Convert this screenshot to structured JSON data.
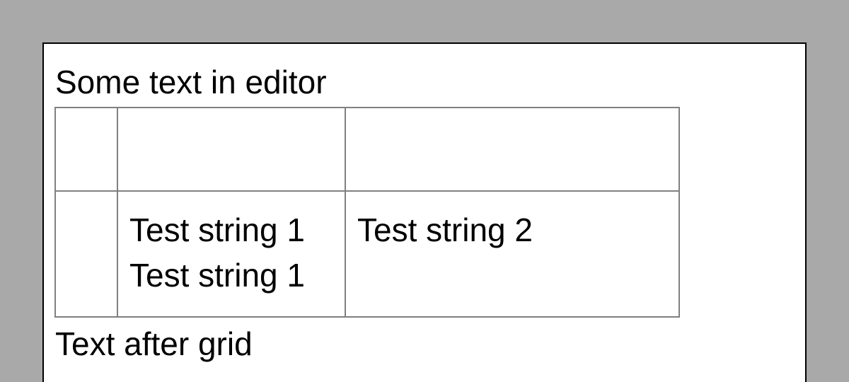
{
  "editor": {
    "text_before": "Some text in editor",
    "text_after": "Text after grid"
  },
  "grid": {
    "rows": [
      {
        "cells": [
          {
            "lines": []
          },
          {
            "lines": []
          },
          {
            "lines": []
          }
        ]
      },
      {
        "cells": [
          {
            "lines": []
          },
          {
            "lines": [
              "Test string 1",
              "Test string 1"
            ]
          },
          {
            "lines": [
              "Test string 2"
            ]
          }
        ]
      }
    ]
  },
  "colors": {
    "background": "#a9a9a9",
    "editor_background": "#ffffff",
    "editor_border": "#000000",
    "grid_border": "#808080"
  }
}
